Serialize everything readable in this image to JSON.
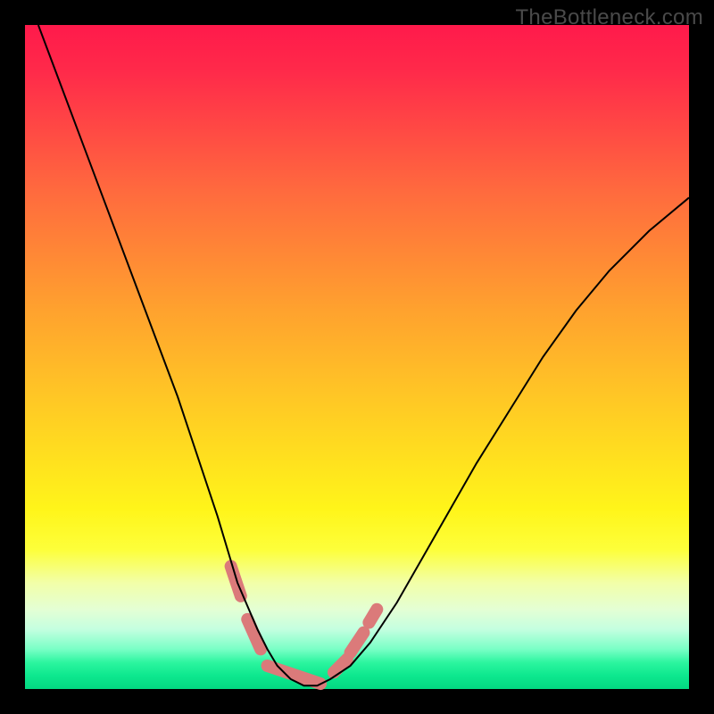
{
  "watermark": "TheBottleneck.com",
  "chart_data": {
    "type": "line",
    "title": "",
    "xlabel": "",
    "ylabel": "",
    "xlim": [
      0,
      100
    ],
    "ylim": [
      0,
      100
    ],
    "grid": false,
    "legend": false,
    "series": [
      {
        "name": "bottleneck-curve",
        "color": "#000000",
        "stroke_width": 2,
        "x": [
          2,
          5,
          8,
          11,
          14,
          17,
          20,
          23,
          25,
          27,
          29,
          30.5,
          32,
          33.5,
          35,
          36.5,
          38,
          40,
          42,
          44,
          46,
          49,
          52,
          56,
          60,
          64,
          68,
          73,
          78,
          83,
          88,
          94,
          100
        ],
        "y": [
          100,
          92,
          84,
          76,
          68,
          60,
          52,
          44,
          38,
          32,
          26,
          21,
          16,
          12.5,
          9,
          6,
          3.5,
          1.5,
          0.5,
          0.5,
          1.5,
          3.5,
          7,
          13,
          20,
          27,
          34,
          42,
          50,
          57,
          63,
          69,
          74
        ]
      },
      {
        "name": "marked-region",
        "color": "#db7a7a",
        "stroke_width": 14,
        "linecap": "round",
        "segments": [
          {
            "x": [
              31.0,
              32.5
            ],
            "y": [
              18.5,
              14.0
            ]
          },
          {
            "x": [
              33.5,
              35.5
            ],
            "y": [
              10.5,
              6.0
            ]
          },
          {
            "x": [
              36.5,
              44.5
            ],
            "y": [
              3.5,
              0.8
            ]
          },
          {
            "x": [
              46.5,
              48.5
            ],
            "y": [
              2.5,
              4.5
            ]
          },
          {
            "x": [
              49.0,
              51.0
            ],
            "y": [
              5.5,
              8.5
            ]
          },
          {
            "x": [
              51.8,
              53.0
            ],
            "y": [
              10.0,
              12.0
            ]
          }
        ]
      }
    ]
  }
}
